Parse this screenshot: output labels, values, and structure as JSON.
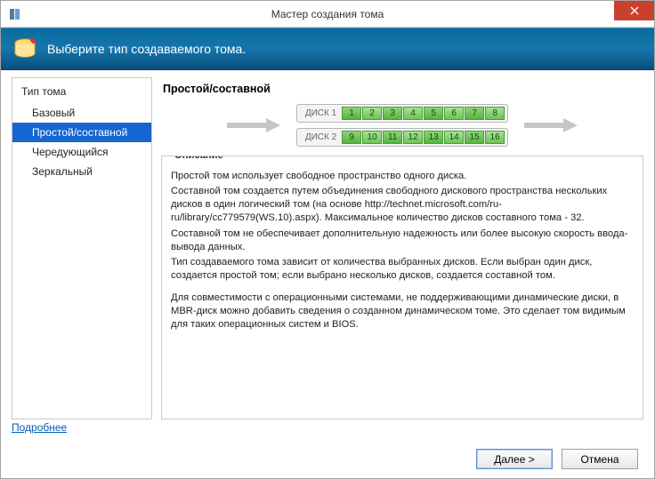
{
  "titlebar": {
    "title": "Мастер создания тома"
  },
  "banner": {
    "text": "Выберите тип создаваемого тома."
  },
  "sidebar": {
    "header": "Тип тома",
    "items": [
      {
        "label": "Базовый",
        "selected": false
      },
      {
        "label": "Простой/составной",
        "selected": true
      },
      {
        "label": "Чередующийся",
        "selected": false
      },
      {
        "label": "Зеркальный",
        "selected": false
      }
    ]
  },
  "main": {
    "title": "Простой/составной",
    "disks": {
      "disk1_label": "ДИСК 1",
      "disk2_label": "ДИСК 2",
      "disk1_blocks": [
        "1",
        "2",
        "3",
        "4",
        "5",
        "6",
        "7",
        "8"
      ],
      "disk2_blocks": [
        "9",
        "10",
        "11",
        "12",
        "13",
        "14",
        "15",
        "16"
      ]
    }
  },
  "description": {
    "legend": "Описание",
    "p1": "Простой том использует свободное пространство одного диска.",
    "p2": "Составной том создается путем объединения свободного дискового пространства нескольких дисков в один логический том (на основе http://technet.microsoft.com/ru-ru/library/cc779579(WS.10).aspx). Максимальное количество дисков составного тома - 32.",
    "p3": "Составной том не обеспечивает дополнительную надежность или более высокую скорость ввода-вывода данных.",
    "p4": "Тип создаваемого тома зависит от количества выбранных дисков. Если выбран один диск, создается простой том; если выбрано несколько дисков, создается составной том.",
    "p5": "Для совместимости с операционными системами, не поддерживающими динамические диски, в MBR-диск можно добавить сведения о созданном динамическом томе. Это сделает том видимым для таких операционных систем и BIOS."
  },
  "link": {
    "more": "Подробнее"
  },
  "buttons": {
    "next": "Далее >",
    "cancel": "Отмена"
  }
}
